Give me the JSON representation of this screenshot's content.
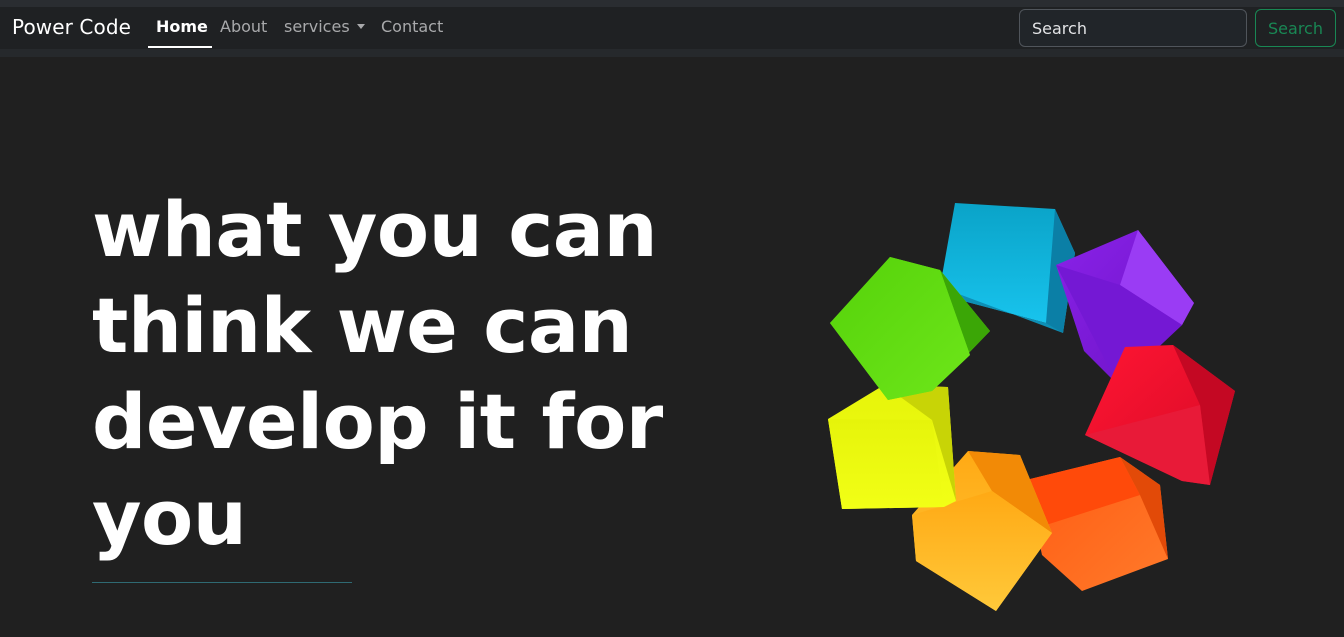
{
  "brand": "Power Code",
  "nav": {
    "home": "Home",
    "about": "About",
    "services": "services",
    "contact": "Contact"
  },
  "search": {
    "placeholder": "Search",
    "button": "Search"
  },
  "hero": {
    "lines": [
      "what you can",
      "think we can",
      "develop it for",
      "you"
    ]
  },
  "colors": {
    "background": "#202020",
    "navbar": "#1f2123",
    "search_accent": "#198754"
  },
  "illustration": "colorful-cubes-ring"
}
